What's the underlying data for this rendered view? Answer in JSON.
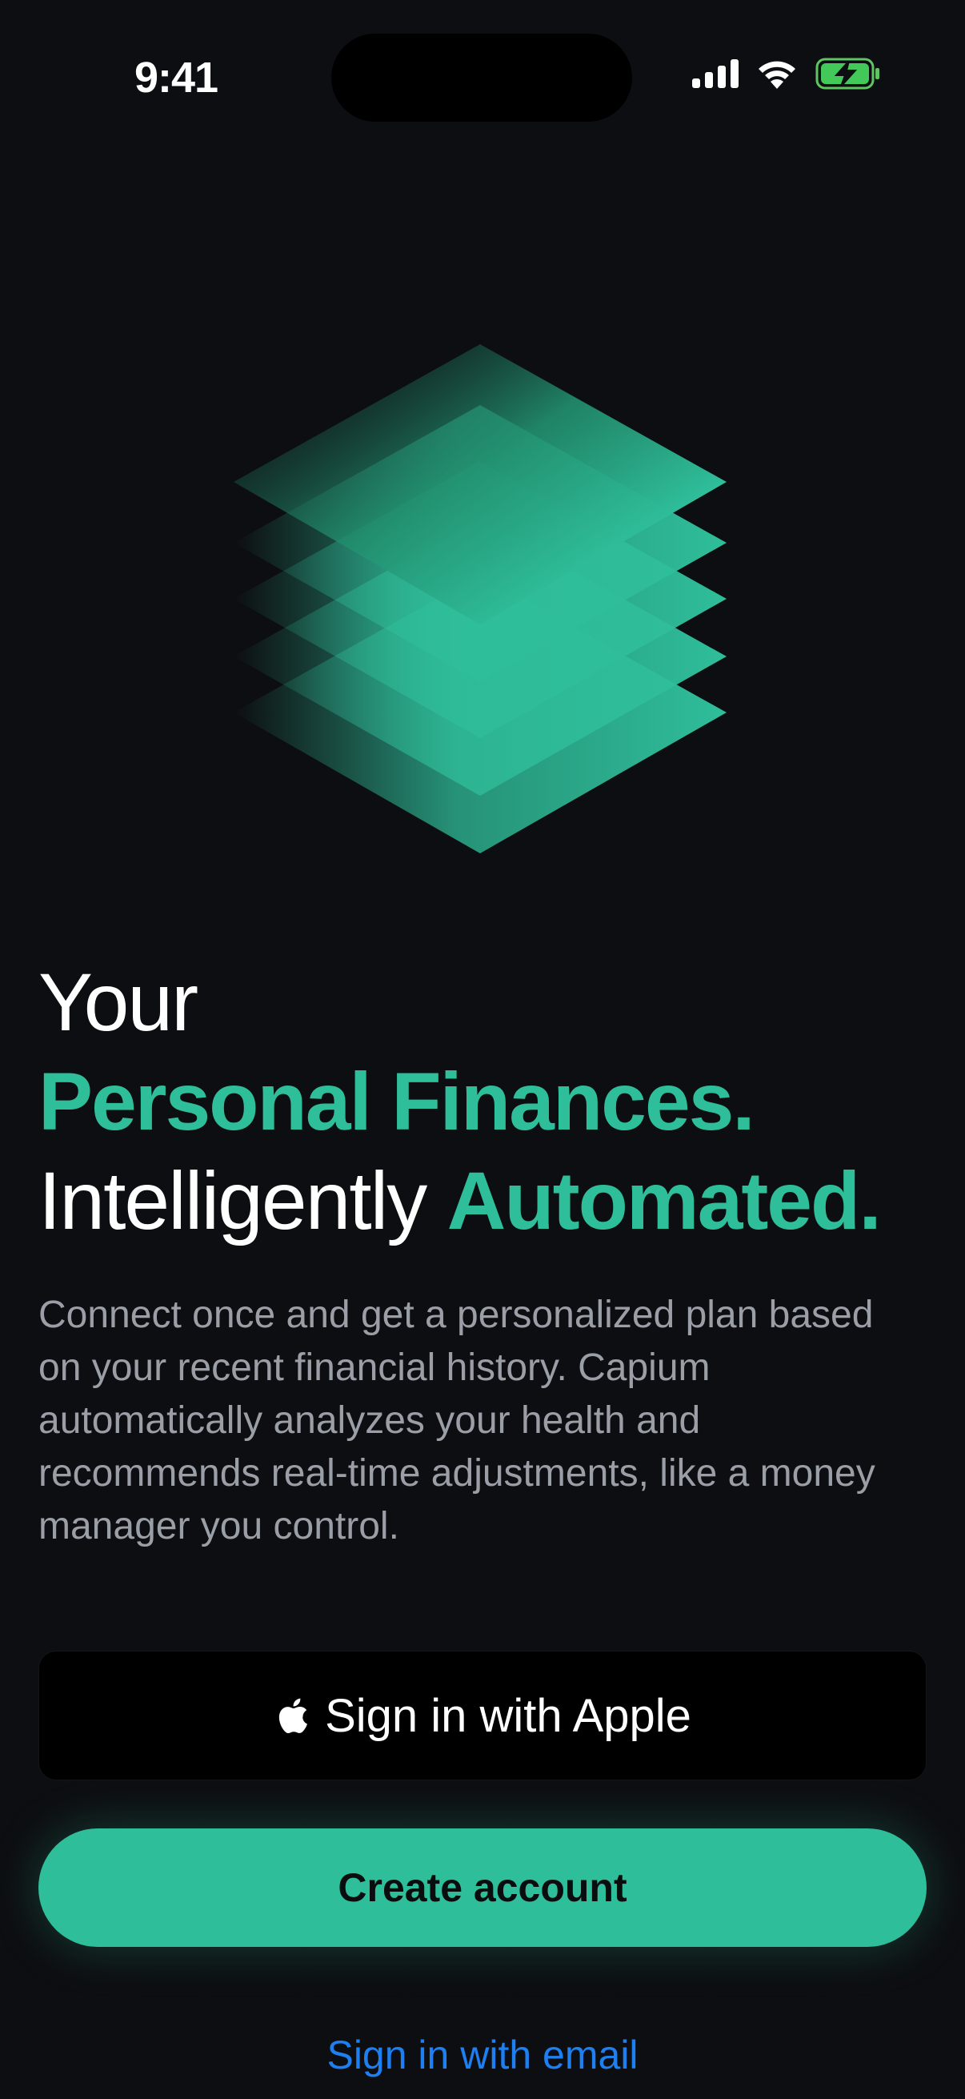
{
  "status_bar": {
    "time": "9:41",
    "icons": [
      "signal-icon",
      "wifi-icon",
      "battery-charging-icon"
    ]
  },
  "hero": {
    "illustration": "stacked-layers-illustration",
    "colors": {
      "accent": "#2fbe9a",
      "background": "#0d0e11"
    }
  },
  "headline": {
    "line1": "Your",
    "line2": "Personal Finances.",
    "line3_plain": "Intelligently",
    "line3_accent": "Automated."
  },
  "description": "Connect once and get a personalized plan based on your recent financial history. Capium automatically analyzes your health and recommends real-time adjustments, like a money manager you control.",
  "actions": {
    "apple_label": "Sign in with Apple",
    "apple_icon": "apple-logo-icon",
    "create_label": "Create account",
    "email_label": "Sign in with email"
  }
}
